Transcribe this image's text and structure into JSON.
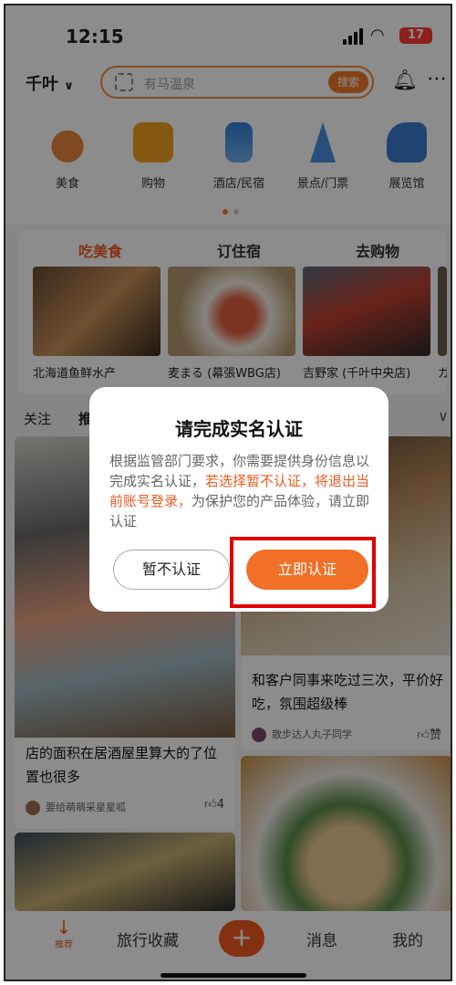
{
  "status_bar": {
    "time": "12:15",
    "battery": "17"
  },
  "header": {
    "city": "千叶",
    "search_placeholder": "有马温泉",
    "search_button": "搜索"
  },
  "categories": [
    {
      "label": "美食",
      "icon": "roast-chicken-icon",
      "color": "#e8863c"
    },
    {
      "label": "购物",
      "icon": "shopping-bag-icon",
      "color": "#f0a020"
    },
    {
      "label": "酒店/民宿",
      "icon": "hotel-building-icon",
      "color": "#2f7fd6"
    },
    {
      "label": "景点/门票",
      "icon": "eiffel-tower-icon",
      "color": "#4a8ee0"
    },
    {
      "label": "展览馆",
      "icon": "museum-icon",
      "color": "#3a7ccf"
    }
  ],
  "section_tabs": [
    "吃美食",
    "订住宿",
    "去购物"
  ],
  "restaurants": [
    "北海道鱼鲜水产",
    "麦まる (幕張WBG店)",
    "吉野家 (千叶中央店)",
    "ガン"
  ],
  "feed_tabs": {
    "follow": "关注",
    "recommend": "推"
  },
  "feed": [
    {
      "title": "店的面积在居酒屋里算大的了位置也很多",
      "user": "要给萌萌采星星呱",
      "likes": "4"
    },
    {
      "title": "和客户同事来吃过三次，平价好吃，氛围超级棒",
      "user": "散步达人丸子同学",
      "likes": "赞"
    }
  ],
  "bottom_nav": {
    "recommend": "推荐",
    "favorites": "旅行收藏",
    "plus": "+",
    "messages": "消息",
    "me": "我的"
  },
  "dialog": {
    "title": "请完成实名认证",
    "body_pre": "根据监管部门要求，你需要提供身份信息以完成实名认证，",
    "body_warn": "若选择暂不认证，将退出当前账号登录，",
    "body_post": "为保护您的产品体验，请立即认证",
    "cancel": "暂不认证",
    "confirm": "立即认证"
  },
  "colors": {
    "accent": "#f05a20",
    "highlight_box": "#e00000"
  }
}
